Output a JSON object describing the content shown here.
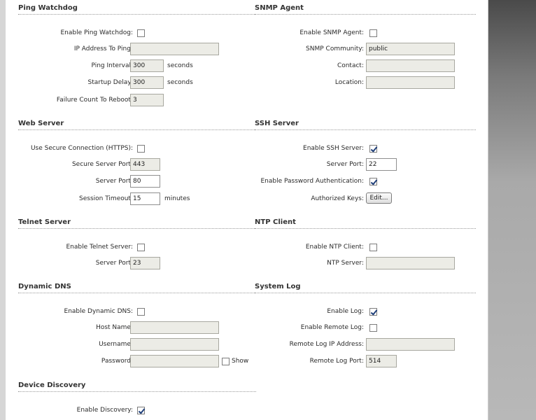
{
  "ping_watchdog": {
    "title": "Ping Watchdog",
    "enable_label": "Enable Ping Watchdog:",
    "enable_checked": false,
    "ip_label": "IP Address To Ping:",
    "ip_value": "",
    "interval_label": "Ping Interval:",
    "interval_value": "300",
    "interval_unit": "seconds",
    "startup_label": "Startup Delay:",
    "startup_value": "300",
    "startup_unit": "seconds",
    "failure_label": "Failure Count To Reboot:",
    "failure_value": "3"
  },
  "snmp_agent": {
    "title": "SNMP Agent",
    "enable_label": "Enable SNMP Agent:",
    "enable_checked": false,
    "community_label": "SNMP Community:",
    "community_value": "public",
    "contact_label": "Contact:",
    "contact_value": "",
    "location_label": "Location:",
    "location_value": ""
  },
  "web_server": {
    "title": "Web Server",
    "https_label": "Use Secure Connection (HTTPS):",
    "https_checked": false,
    "secure_port_label": "Secure Server Port:",
    "secure_port_value": "443",
    "port_label": "Server Port:",
    "port_value": "80",
    "timeout_label": "Session Timeout:",
    "timeout_value": "15",
    "timeout_unit": "minutes"
  },
  "ssh_server": {
    "title": "SSH Server",
    "enable_label": "Enable SSH Server:",
    "enable_checked": true,
    "port_label": "Server Port:",
    "port_value": "22",
    "password_auth_label": "Enable Password Authentication:",
    "password_auth_checked": true,
    "keys_label": "Authorized Keys:",
    "keys_button": "Edit..."
  },
  "telnet_server": {
    "title": "Telnet Server",
    "enable_label": "Enable Telnet Server:",
    "enable_checked": false,
    "port_label": "Server Port:",
    "port_value": "23"
  },
  "ntp_client": {
    "title": "NTP Client",
    "enable_label": "Enable NTP Client:",
    "enable_checked": false,
    "server_label": "NTP Server:",
    "server_value": ""
  },
  "dynamic_dns": {
    "title": "Dynamic DNS",
    "enable_label": "Enable Dynamic DNS:",
    "enable_checked": false,
    "host_label": "Host Name:",
    "host_value": "",
    "user_label": "Username:",
    "user_value": "",
    "password_label": "Password:",
    "password_value": "",
    "show_label": "Show",
    "show_checked": false
  },
  "system_log": {
    "title": "System Log",
    "enable_label": "Enable Log:",
    "enable_checked": true,
    "remote_label": "Enable Remote Log:",
    "remote_checked": false,
    "remote_ip_label": "Remote Log IP Address:",
    "remote_ip_value": "",
    "remote_port_label": "Remote Log Port:",
    "remote_port_value": "514"
  },
  "device_discovery": {
    "title": "Device Discovery",
    "enable_label": "Enable Discovery:",
    "enable_checked": true
  }
}
